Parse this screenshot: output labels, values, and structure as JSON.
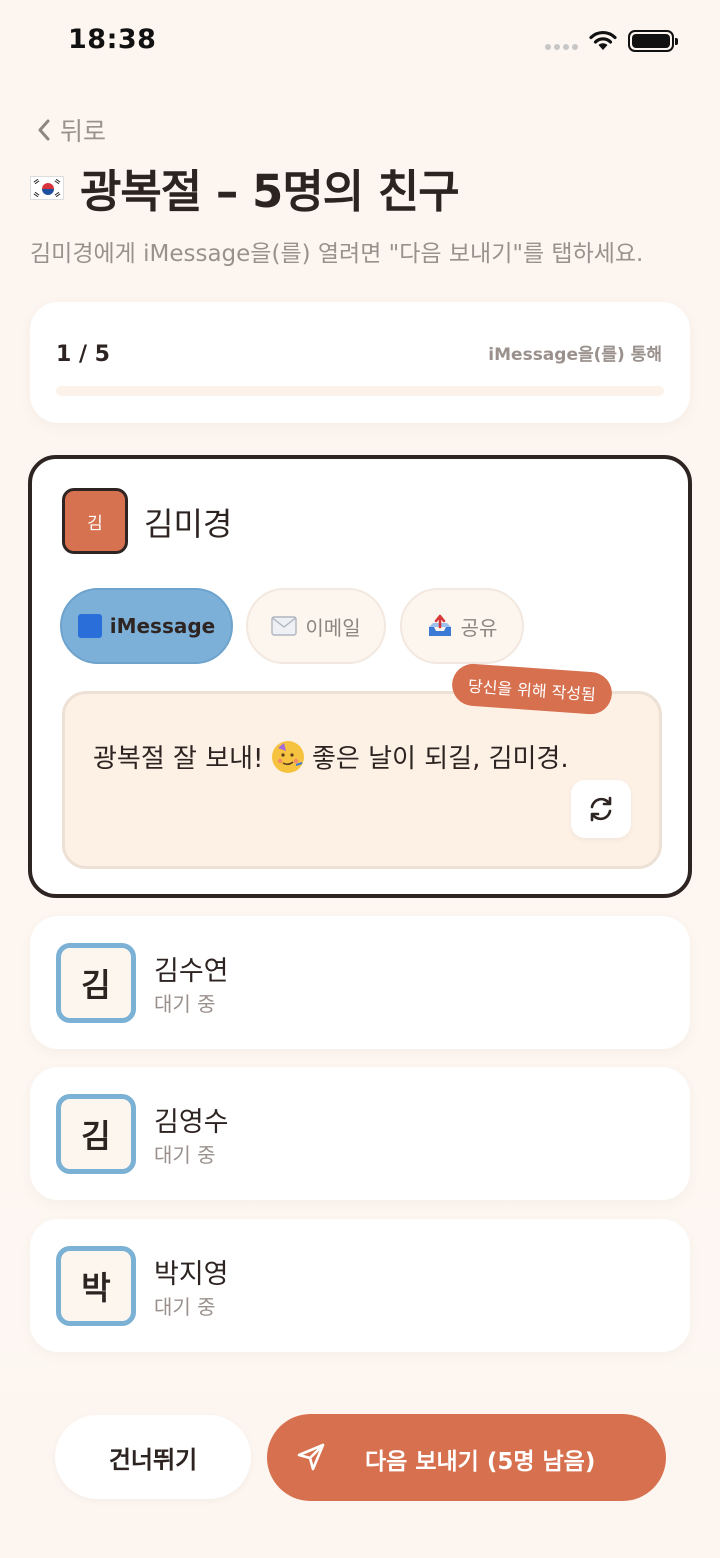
{
  "status_bar": {
    "time": "18:38"
  },
  "nav": {
    "back_label": "뒤로"
  },
  "header": {
    "title": "광복절 – 5명의 친구",
    "subtitle": "김미경에게 iMessage을(를) 열려면 \"다음 보내기\"를 탭하세요."
  },
  "progress": {
    "count": "1 / 5",
    "via": "iMessage을(를) 통해",
    "fraction": 0
  },
  "active": {
    "avatar_initial": "김",
    "name": "김미경",
    "channels": [
      {
        "label": "iMessage",
        "icon": "blue-square-icon",
        "selected": true
      },
      {
        "label": "이메일",
        "icon": "envelope-icon",
        "selected": false
      },
      {
        "label": "공유",
        "icon": "outbox-tray-icon",
        "selected": false
      }
    ],
    "badge": "당신을 위해 작성됨",
    "message_before": "광복절 잘 보내! ",
    "message_after": " 좋은 날이 되길, 김미경.",
    "emoji": "partying-face-icon"
  },
  "friends": [
    {
      "initial": "김",
      "name": "김수연",
      "status": "대기 중"
    },
    {
      "initial": "김",
      "name": "김영수",
      "status": "대기 중"
    },
    {
      "initial": "박",
      "name": "박지영",
      "status": "대기 중"
    }
  ],
  "actions": {
    "skip_label": "건너뛰기",
    "send_label": "다음 보내기 (5명 남음)"
  },
  "colors": {
    "accent": "#d7704f",
    "imessage_chip": "#7cb0d8",
    "background": "#fdf6f0",
    "text_dark": "#2d2422",
    "text_muted": "#9a918d"
  }
}
